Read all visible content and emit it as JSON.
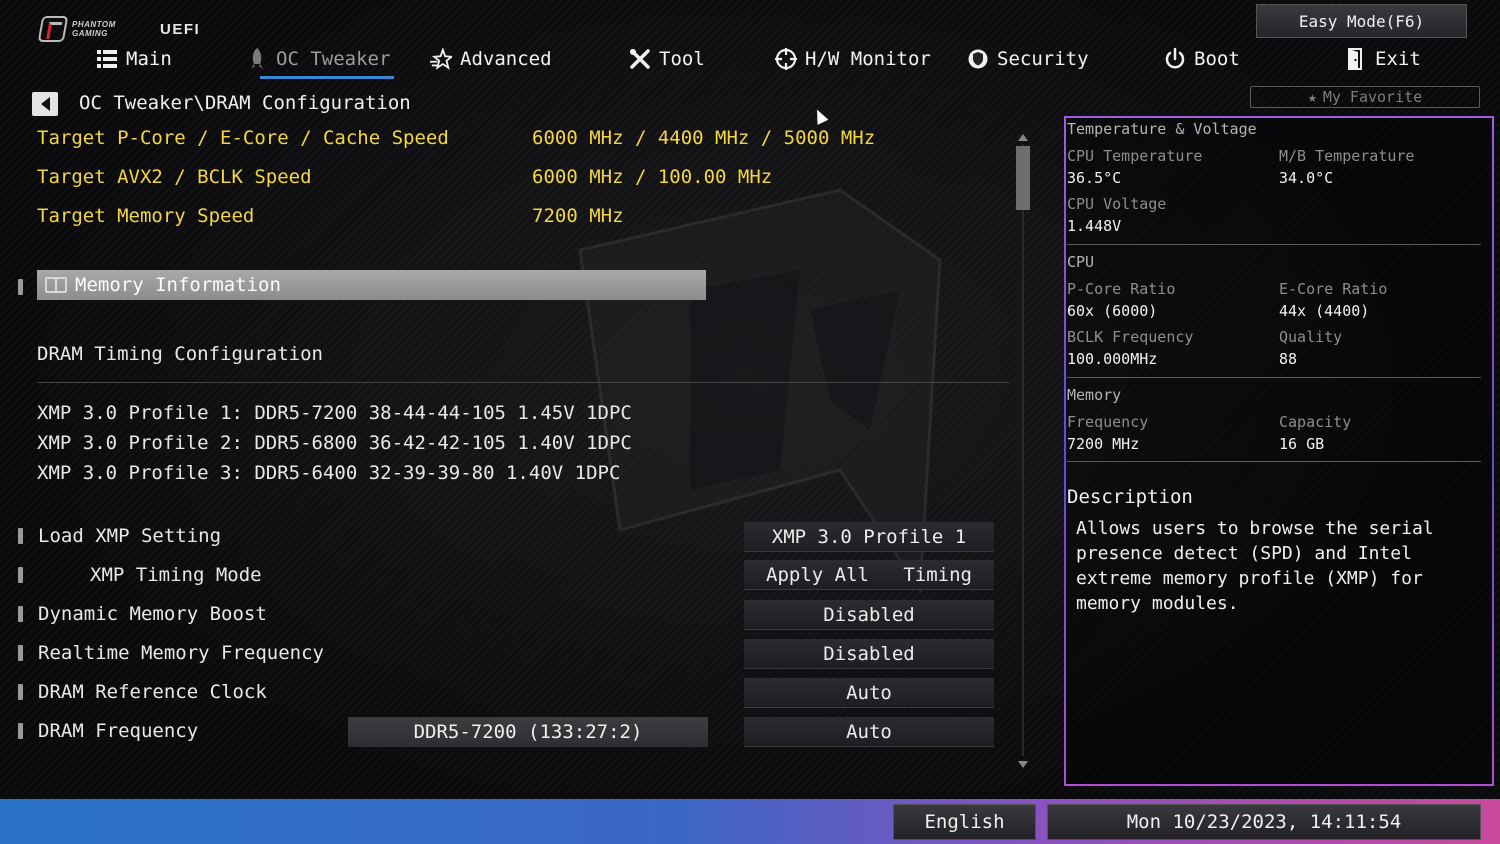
{
  "brand": {
    "logo_text": "PHANTOM GAMING",
    "uefi_label": "UEFI"
  },
  "header": {
    "easy_mode_label": "Easy Mode(F6)",
    "my_favorite_label": "My Favorite"
  },
  "nav": [
    {
      "label": "Main",
      "icon": "list-icon"
    },
    {
      "label": "OC Tweaker",
      "icon": "rocket-icon",
      "active": true
    },
    {
      "label": "Advanced",
      "icon": "star-icon"
    },
    {
      "label": "Tool",
      "icon": "tools-icon"
    },
    {
      "label": "H/W Monitor",
      "icon": "crosshair-icon"
    },
    {
      "label": "Security",
      "icon": "shield-icon"
    },
    {
      "label": "Boot",
      "icon": "power-icon"
    },
    {
      "label": "Exit",
      "icon": "door-icon"
    }
  ],
  "breadcrumb": "OC Tweaker\\DRAM Configuration",
  "targets": [
    {
      "label": "Target P-Core / E-Core / Cache Speed",
      "value": "6000 MHz / 4400 MHz / 5000 MHz"
    },
    {
      "label": "Target AVX2 / BCLK Speed",
      "value": "6000 MHz / 100.00 MHz"
    },
    {
      "label": "Target Memory Speed",
      "value": "7200 MHz"
    }
  ],
  "memory_information_label": "Memory Information",
  "dram_timing_label": "DRAM Timing Configuration",
  "xmp_profiles": [
    "XMP 3.0 Profile 1: DDR5-7200 38-44-44-105 1.45V 1DPC",
    "XMP 3.0 Profile 2: DDR5-6800 36-42-42-105 1.40V 1DPC",
    "XMP 3.0 Profile 3: DDR5-6400 32-39-39-80 1.40V 1DPC"
  ],
  "settings": {
    "load_xmp": {
      "label": "Load XMP Setting",
      "value": "XMP 3.0 Profile 1"
    },
    "xmp_timing_mode": {
      "label": "XMP Timing Mode",
      "value_left": "Apply All",
      "value_right": "Timing"
    },
    "dynamic_memory_boost": {
      "label": "Dynamic Memory Boost",
      "value": "Disabled"
    },
    "realtime_memory_frequency": {
      "label": "Realtime Memory Frequency",
      "value": "Disabled"
    },
    "dram_reference_clock": {
      "label": "DRAM Reference Clock",
      "value": "Auto"
    },
    "dram_frequency": {
      "label": "DRAM Frequency",
      "current": "DDR5-7200 (133:27:2)",
      "value": "Auto"
    }
  },
  "monitor": {
    "title": "Temperature & Voltage",
    "cpu_temp_label": "CPU Temperature",
    "cpu_temp_value": "36.5°C",
    "mb_temp_label": "M/B Temperature",
    "mb_temp_value": "34.0°C",
    "cpu_voltage_label": "CPU Voltage",
    "cpu_voltage_value": "1.448V",
    "cpu_section": "CPU",
    "pcore_ratio_label": "P-Core Ratio",
    "pcore_ratio_value": "60x (6000)",
    "ecore_ratio_label": "E-Core Ratio",
    "ecore_ratio_value": "44x (4400)",
    "bclk_label": "BCLK Frequency",
    "bclk_value": "100.000MHz",
    "quality_label": "Quality",
    "quality_value": "88",
    "memory_section": "Memory",
    "freq_label": "Frequency",
    "freq_value": "7200 MHz",
    "capacity_label": "Capacity",
    "capacity_value": "16 GB"
  },
  "description": {
    "title": "Description",
    "text": "Allows users to browse the serial\npresence detect (SPD) and Intel\nextreme memory profile (XMP) for\nmemory modules."
  },
  "footer": {
    "language": "English",
    "datetime": "Mon 10/23/2023, 14:11:54"
  },
  "colors": {
    "accent_yellow": "#f4d640",
    "tab_underline": "#3c86d6",
    "panel_border": "#8a50dc",
    "footer_left": "#2a73c8",
    "footer_right": "#c8499e"
  }
}
